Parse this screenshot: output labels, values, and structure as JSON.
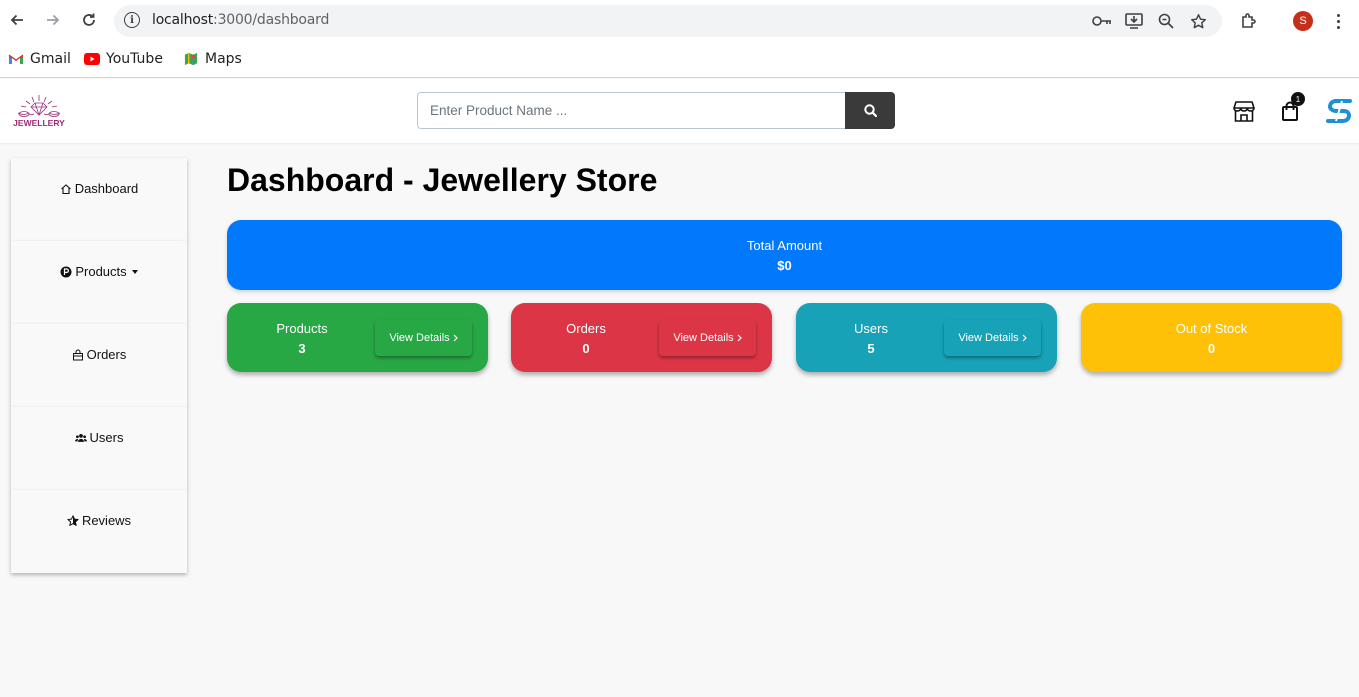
{
  "browser": {
    "url_host": "localhost",
    "url_path": ":3000/dashboard",
    "profile_initial": "S",
    "bookmarks": [
      {
        "label": "Gmail",
        "icon": "gmail-icon"
      },
      {
        "label": "YouTube",
        "icon": "youtube-icon"
      },
      {
        "label": "Maps",
        "icon": "maps-icon"
      }
    ]
  },
  "header": {
    "logo_text": "JEWELLERY",
    "search_placeholder": "Enter Product Name ...",
    "cart_count": "1"
  },
  "sidebar": {
    "items": [
      {
        "label": "Dashboard",
        "icon": "home-icon"
      },
      {
        "label": "Products",
        "icon": "product-icon",
        "has_caret": true
      },
      {
        "label": "Orders",
        "icon": "orders-icon"
      },
      {
        "label": "Users",
        "icon": "users-icon"
      },
      {
        "label": "Reviews",
        "icon": "reviews-icon"
      }
    ]
  },
  "main": {
    "title": "Dashboard - Jewellery Store",
    "total": {
      "title": "Total Amount",
      "value": "$0"
    },
    "cards": [
      {
        "title": "Products",
        "value": "3",
        "button": "View Details",
        "color": "#28a745"
      },
      {
        "title": "Orders",
        "value": "0",
        "button": "View Details",
        "color": "#dc3545"
      },
      {
        "title": "Users",
        "value": "5",
        "button": "View Details",
        "color": "#17a2b8"
      },
      {
        "title": "Out of Stock",
        "value": "0",
        "color": "#ffc107"
      }
    ]
  },
  "colors": {
    "total_card": "#0279fd",
    "products_card": "#28a745",
    "orders_card": "#dc3545",
    "users_card": "#17a2b8",
    "stock_card": "#ffc107",
    "search_button": "#3a3a3a"
  }
}
